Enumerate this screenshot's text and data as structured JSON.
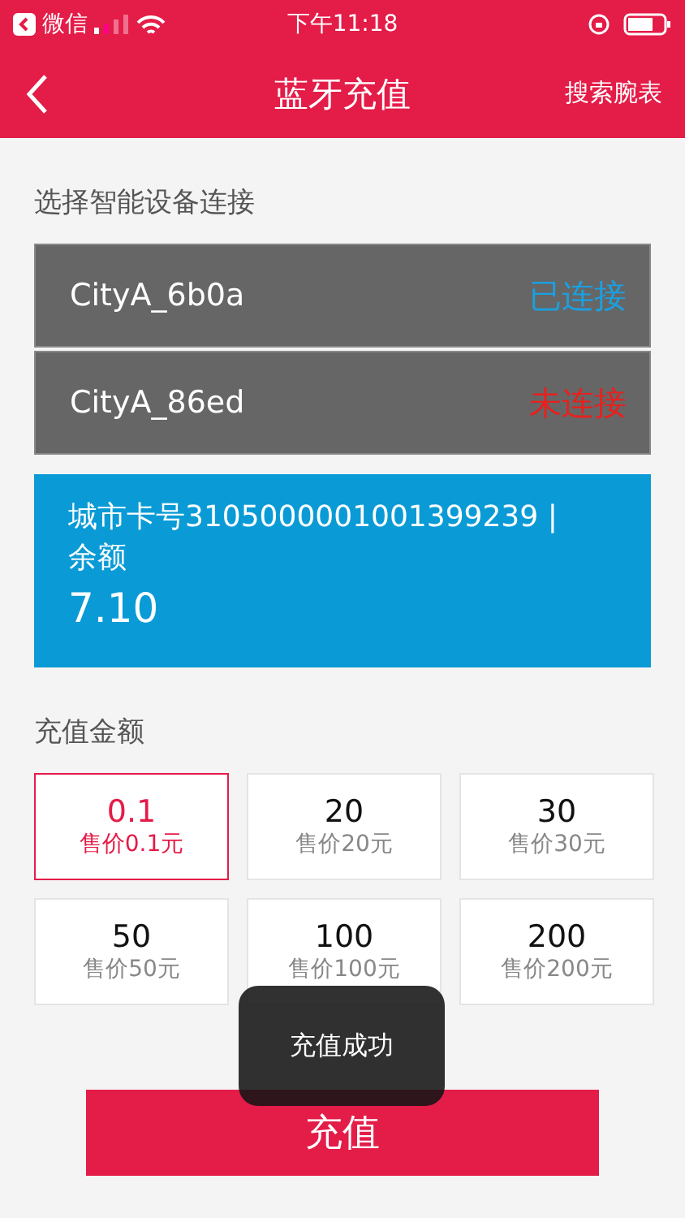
{
  "status_bar": {
    "back_app": "微信",
    "time": "下午11:18"
  },
  "header": {
    "title": "蓝牙充值",
    "action": "搜索腕表"
  },
  "devices_label": "选择智能设备连接",
  "devices": [
    {
      "name": "CityA_6b0a",
      "status": "已连接",
      "connected": true
    },
    {
      "name": "CityA_86ed",
      "status": "未连接",
      "connected": false
    }
  ],
  "card": {
    "info": "城市卡号3105000001001399239 | 余额",
    "balance": "7.10"
  },
  "amount_label": "充值金额",
  "amounts": [
    {
      "value": "0.1",
      "price": "售价0.1元",
      "selected": true
    },
    {
      "value": "20",
      "price": "售价20元",
      "selected": false
    },
    {
      "value": "30",
      "price": "售价30元",
      "selected": false
    },
    {
      "value": "50",
      "price": "售价50元",
      "selected": false
    },
    {
      "value": "100",
      "price": "售价100元",
      "selected": false
    },
    {
      "value": "200",
      "price": "售价200元",
      "selected": false
    }
  ],
  "toast": "充值成功",
  "submit": "充值"
}
